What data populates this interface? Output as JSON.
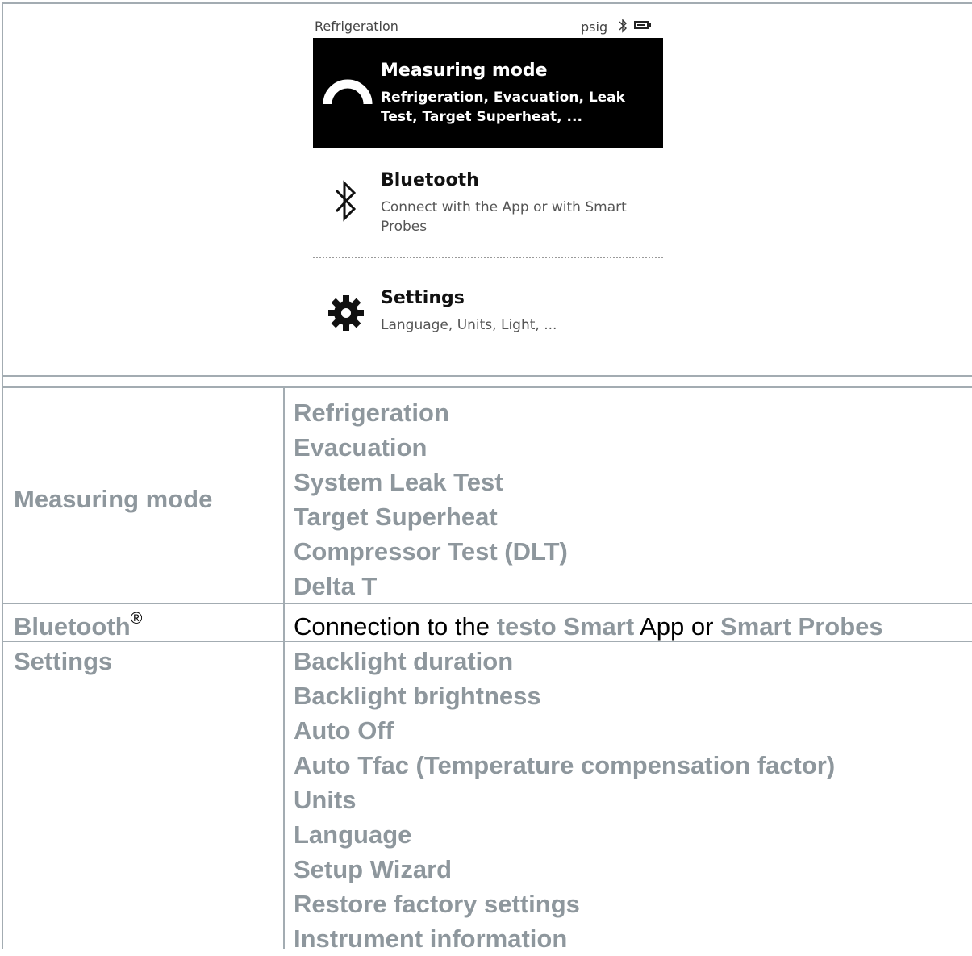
{
  "device_screen": {
    "status_title": "Refrigeration",
    "unit": "psig",
    "items": [
      {
        "name": "Measuring mode",
        "desc": "Refrigeration, Evacuation, Leak Test, Target Superheat, ...",
        "icon": "gauge-icon",
        "selected": true
      },
      {
        "name": "Bluetooth",
        "desc": "Connect with the App or with Smart Probes",
        "icon": "bluetooth-icon",
        "selected": false
      },
      {
        "name": "Settings",
        "desc": "Language, Units, Light, ...",
        "icon": "gear-icon",
        "selected": false
      }
    ]
  },
  "table": {
    "measuring_mode": {
      "label": "Measuring mode",
      "options": [
        "Refrigeration",
        "Evacuation",
        "System Leak Test",
        "Target Superheat",
        "Compressor Test (DLT)",
        "Delta T"
      ]
    },
    "bluetooth": {
      "label": "Bluetooth",
      "reg_mark": "®",
      "text_1": "Connection to the ",
      "link_1": "testo Smart",
      "text_2": " App or ",
      "link_2": "Smart Probes"
    },
    "settings": {
      "label": "Settings",
      "options": [
        "Backlight duration",
        "Backlight brightness",
        "Auto Off",
        "Auto Tfac (Temperature compensation factor)",
        "Units",
        "Language",
        "Setup Wizard",
        "Restore factory settings",
        "Instrument information"
      ]
    }
  },
  "colors": {
    "border": "#a3acb2",
    "highlight_text": "#8e979d",
    "body_text": "#000000"
  }
}
